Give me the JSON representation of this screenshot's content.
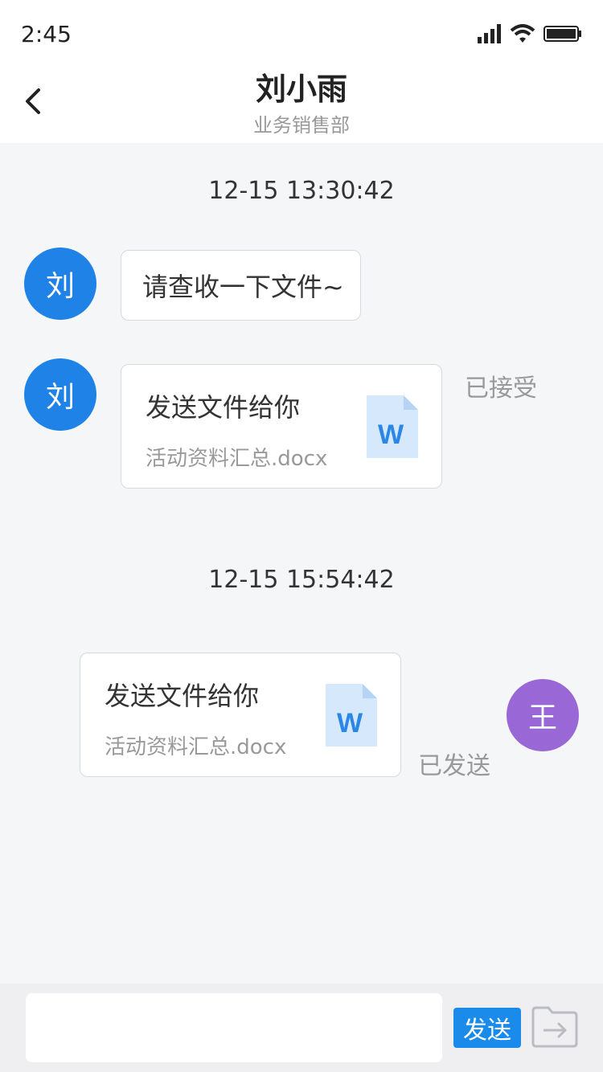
{
  "status_bar": {
    "time": "2:45"
  },
  "header": {
    "title": "刘小雨",
    "subtitle": "业务销售部"
  },
  "messages": [
    {
      "timestamp": "12-15 13:30:42"
    },
    {
      "avatar": "刘",
      "text": "请查收一下文件~"
    },
    {
      "avatar": "刘",
      "file_title": "发送文件给你",
      "file_name": "活动资料汇总.docx",
      "status": "已接受"
    },
    {
      "timestamp": "12-15 15:54:42"
    },
    {
      "avatar": "王",
      "file_title": "发送文件给你",
      "file_name": "活动资料汇总.docx",
      "status": "已发送"
    }
  ],
  "input_bar": {
    "placeholder": "",
    "send_label": "发送"
  },
  "colors": {
    "accent": "#1a8aeb",
    "avatar_liu": "#1f82e6",
    "avatar_wang": "#9a68d6"
  },
  "icons": [
    "signal-icon",
    "wifi-icon",
    "battery-icon",
    "back-icon",
    "word-file-icon",
    "folder-send-icon"
  ]
}
